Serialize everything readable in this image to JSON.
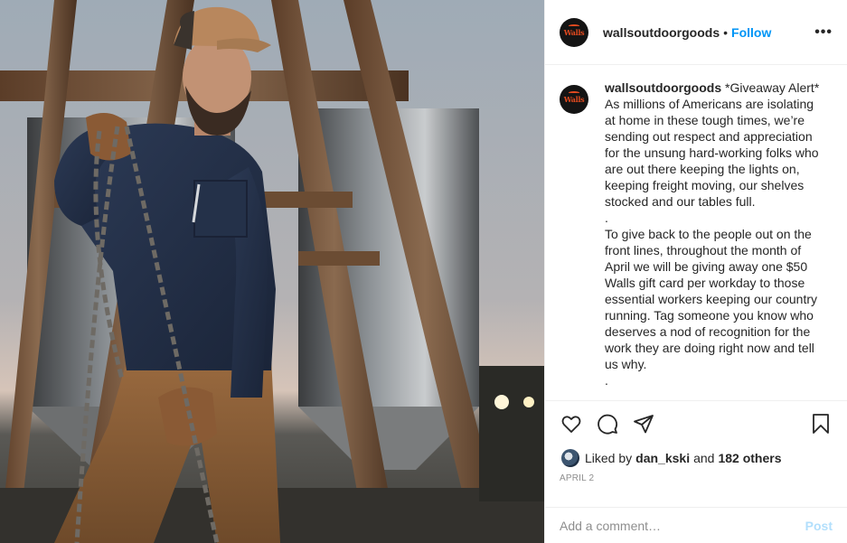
{
  "account": {
    "username": "wallsoutdoorgoods",
    "avatar_text": "Walls",
    "follow_label": "Follow",
    "separator": "•",
    "more_label": "•••"
  },
  "caption": {
    "username": "wallsoutdoorgoods",
    "lines": [
      "*Giveaway Alert*",
      "As millions of Americans are isolating",
      "at home in these tough times, we’re",
      "sending out respect and appreciation",
      "for the unsung hard-working folks who",
      "are out there keeping the lights on,",
      "keeping freight moving, our shelves",
      "stocked and our tables full.",
      ".",
      "To give back to the people out on the",
      "front lines, throughout the month of",
      "April we will be giving away one $50",
      "Walls gift card per workday to those",
      "essential workers keeping our country",
      "running. Tag someone you know who",
      "deserves a nod of recognition for the",
      "work they are doing right now and tell",
      "us why.",
      "."
    ]
  },
  "actions": {
    "like_icon": "heart-icon",
    "comment_icon": "comment-icon",
    "share_icon": "paper-plane-icon",
    "save_icon": "bookmark-icon"
  },
  "likes": {
    "prefix": "Liked by",
    "user": "dan_kski",
    "conjunction": "and",
    "others": "182 others"
  },
  "date": "APRIL 2",
  "comment_box": {
    "placeholder": "Add a comment…",
    "post_label": "Post"
  },
  "colors": {
    "link_blue": "#0095f6",
    "post_disabled": "#b2dffc",
    "brand_orange": "#e24a1f",
    "muted": "#8e8e8e"
  }
}
